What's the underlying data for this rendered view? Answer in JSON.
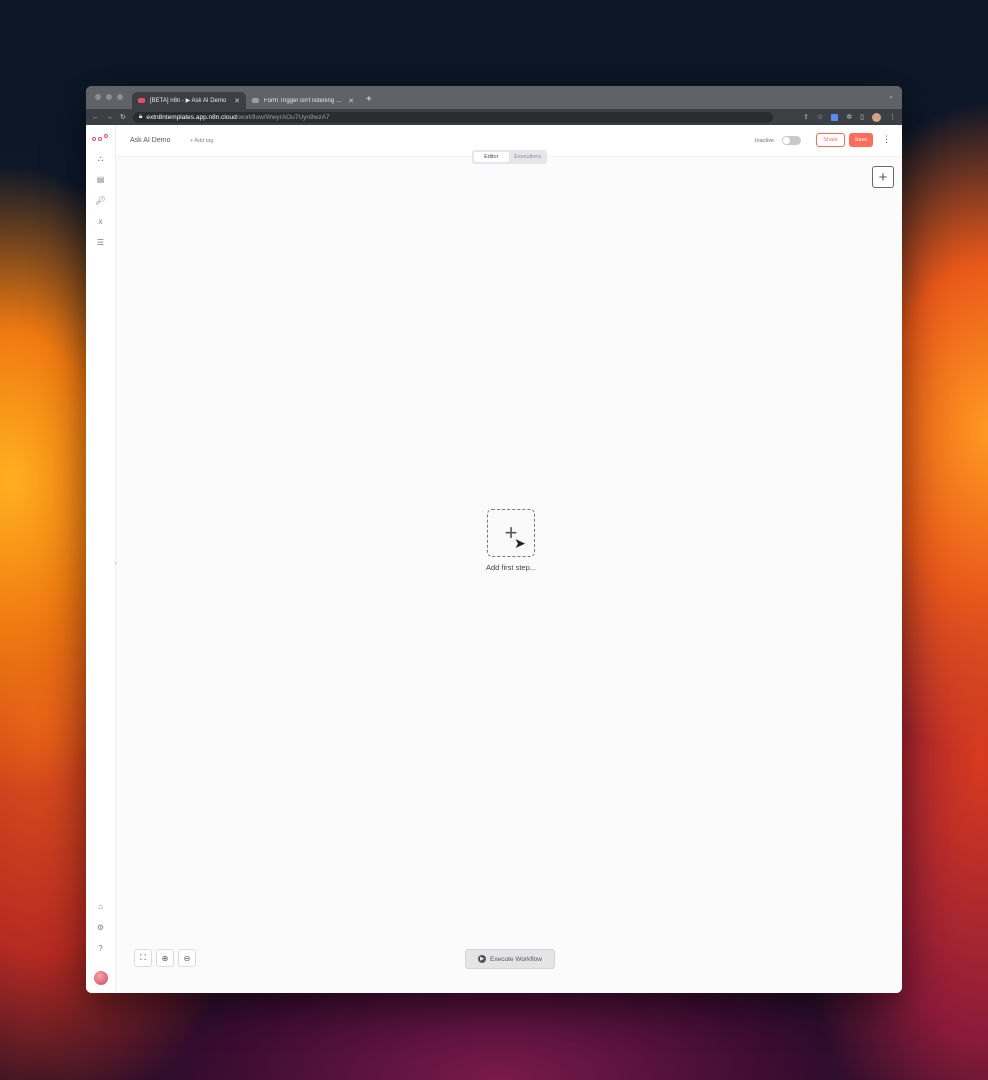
{
  "browser": {
    "tabs": [
      {
        "title": "[BETA] n8n - ▶ Ask AI Demo",
        "active": true
      },
      {
        "title": "Form Trigger isn't listening yet",
        "active": false
      }
    ],
    "new_tab": "+",
    "url_host": "extn8ntemplates.app.n8n.cloud",
    "url_path": "/workflow/WwyrAOu7Uyn9wzA7"
  },
  "header": {
    "workflow_name": "Ask AI Demo",
    "add_tag": "+ Add tag",
    "status_label": "Inactive",
    "share_label": "Share",
    "save_label": "Save",
    "more": "⋮"
  },
  "view_tabs": [
    {
      "label": "Editor",
      "active": true
    },
    {
      "label": "Executions",
      "active": false
    }
  ],
  "canvas": {
    "add_node": "+",
    "first_step_label": "Add first step...",
    "execute_label": "Execute Workflow"
  },
  "icons": {
    "sidebar_top": [
      "workflows-icon",
      "templates-icon",
      "credentials-icon",
      "variables-icon",
      "executions-icon"
    ],
    "sidebar_bottom": [
      "home-icon",
      "settings-icon",
      "help-icon"
    ],
    "zoom": [
      "fit-view-icon",
      "zoom-in-icon",
      "zoom-out-icon"
    ]
  },
  "colors": {
    "brand": "#ea4b71",
    "save": "#ff6d5a"
  }
}
